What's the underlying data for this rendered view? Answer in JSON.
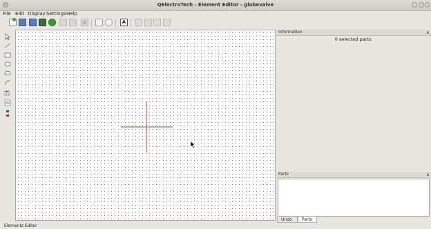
{
  "window": {
    "title": "QElectroTech - Element Editor - globevalve"
  },
  "menu": [
    {
      "label": "File",
      "key": "file"
    },
    {
      "label": "Edit",
      "key": "edit"
    },
    {
      "label": "Display",
      "key": "display"
    },
    {
      "label": "Settings",
      "key": "settings"
    },
    {
      "label": "Help",
      "key": "help"
    }
  ],
  "toolbar": {
    "icons": [
      "new-icon",
      "open-icon",
      "save-icon",
      "save-as-icon",
      "reload-icon",
      "undo-icon",
      "redo-icon",
      "delete-icon",
      "zoom-fit-icon",
      "zoom-in-icon",
      "text-field-icon",
      "copy-icon",
      "paste-icon",
      "paste-area-icon",
      "select-all-icon"
    ],
    "text_tool_label": "A"
  },
  "tools": {
    "icons": [
      "pointer-icon",
      "line-icon",
      "rectangle-icon",
      "ellipse-icon",
      "polygon-icon",
      "arc-icon",
      "text-icon",
      "terminal-icon",
      "text-field-icon"
    ]
  },
  "info_panel": {
    "title": "Information",
    "status": "0 selected parts.",
    "float_label": "อ"
  },
  "parts_panel": {
    "title": "Parts",
    "float_label": "อ"
  },
  "tabs": [
    {
      "label": "Undo",
      "active": false
    },
    {
      "label": "Parts",
      "active": true
    }
  ],
  "status_bar": {
    "text": "Elements Editor"
  },
  "colors": {
    "crosshair": "#c9393a",
    "grid_dot": "#7a7a7a"
  }
}
